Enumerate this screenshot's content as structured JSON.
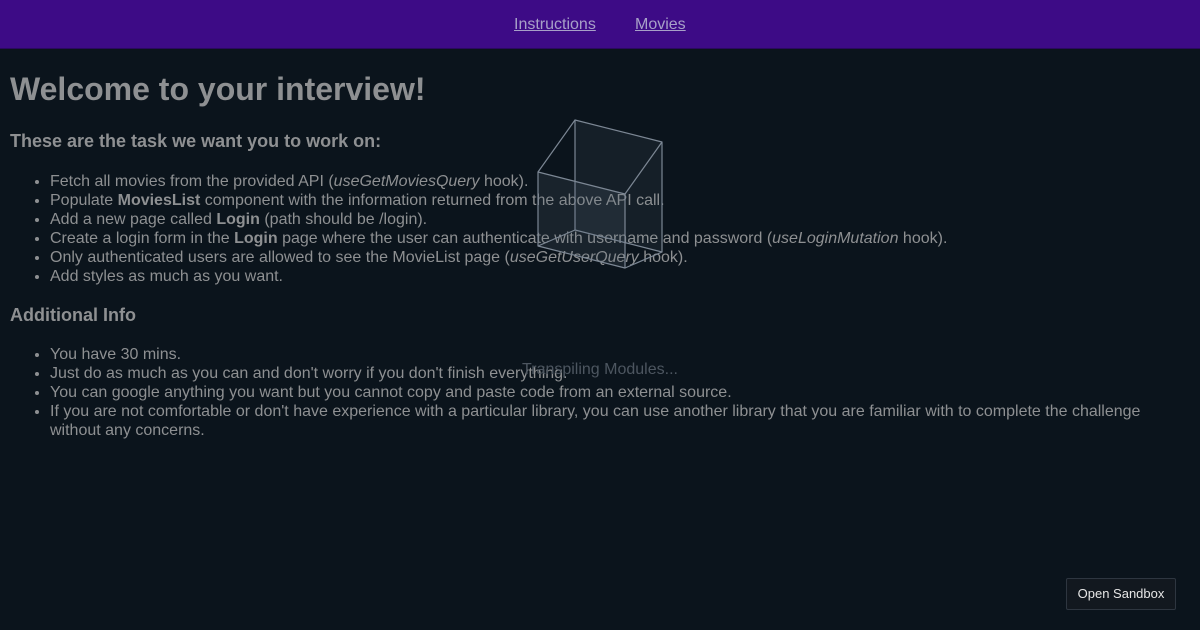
{
  "nav": {
    "instructions": "Instructions",
    "movies": "Movies"
  },
  "main": {
    "title": "Welcome to your interview!",
    "tasks_heading": "These are the task we want you to work on:",
    "tasks": {
      "t1": {
        "a": "Fetch all movies from the provided API (",
        "b": "useGetMoviesQuery",
        "c": " hook)."
      },
      "t2": {
        "a": "Populate ",
        "b": "MoviesList",
        "c": " component with the information returned from the above API call."
      },
      "t3": {
        "a": "Add a new page called ",
        "b": "Login",
        "c": " (path should be /login)."
      },
      "t4": {
        "a": "Create a login form in the ",
        "b": "Login",
        "c": " page where the user can authenticate with username and password (",
        "d": "useLoginMutation",
        "e": " hook)."
      },
      "t5": {
        "a": "Only authenticated users are allowed to see the MovieList page (",
        "b": "useGetUserQuery",
        "c": " hook)."
      },
      "t6": {
        "a": "Add styles as much as you want."
      }
    },
    "info_heading": "Additional Info",
    "info": [
      "You have 30 mins.",
      "Just do as much as you can and don't worry if you don't finish everything.",
      "You can google anything you want but you cannot copy and paste code from an external source.",
      "If you are not comfortable or don't have experience with a particular library, you can use another library that you are familiar with to complete the challenge without any concerns."
    ]
  },
  "loader": {
    "label": "Transpiling Modules...",
    "icon": "cube-icon"
  },
  "actions": {
    "open_sandbox": "Open Sandbox"
  },
  "colors": {
    "background": "#0b141c",
    "nav_background": "#3d0b86",
    "text": "#8e9092"
  }
}
